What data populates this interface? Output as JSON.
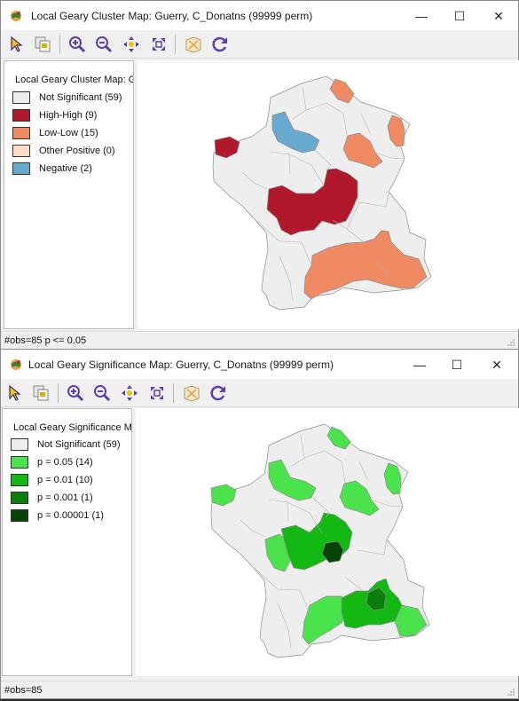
{
  "cluster_window": {
    "title": "Local Geary Cluster Map: Guerry, C_Donatns (99999 perm)",
    "legend_title": "Local Geary Cluster Map: G",
    "legend": [
      {
        "label": "Not Significant (59)",
        "color": "#eeeeee"
      },
      {
        "label": "High-High (9)",
        "color": "#b2182b"
      },
      {
        "label": "Low-Low (15)",
        "color": "#ef8a62"
      },
      {
        "label": "Other Positive (0)",
        "color": "#fddbc7"
      },
      {
        "label": "Negative (2)",
        "color": "#67a9cf"
      }
    ],
    "status": "#obs=85  p <= 0.05"
  },
  "significance_window": {
    "title": "Local Geary Significance Map: Guerry, C_Donatns (99999 perm)",
    "legend_title": "Local Geary Significance Ma",
    "legend": [
      {
        "label": "Not Significant (59)",
        "color": "#eeeeee"
      },
      {
        "label": "p = 0.05 (14)",
        "color": "#4be34b"
      },
      {
        "label": "p = 0.01 (10)",
        "color": "#13b813"
      },
      {
        "label": "p = 0.001 (1)",
        "color": "#0b7f0b"
      },
      {
        "label": "p = 0.00001 (1)",
        "color": "#064406"
      }
    ],
    "status": "#obs=85"
  },
  "window_controls": {
    "minimize": "—",
    "maximize": "☐",
    "close": "✕"
  },
  "toolbar_icons": [
    "select-icon",
    "copy-icon",
    "zoom-in-icon",
    "zoom-out-icon",
    "pan-icon",
    "full-extent-icon",
    "map-layer-icon",
    "refresh-icon"
  ],
  "colors": {
    "outline": "#8c8c8c",
    "nonsig": "#eeeeee",
    "hh": "#b2182b",
    "ll": "#ef8a62",
    "neg": "#67a9cf",
    "p05": "#4be34b",
    "p01": "#13b813",
    "p001": "#0b7f0b",
    "p00001": "#064406"
  }
}
